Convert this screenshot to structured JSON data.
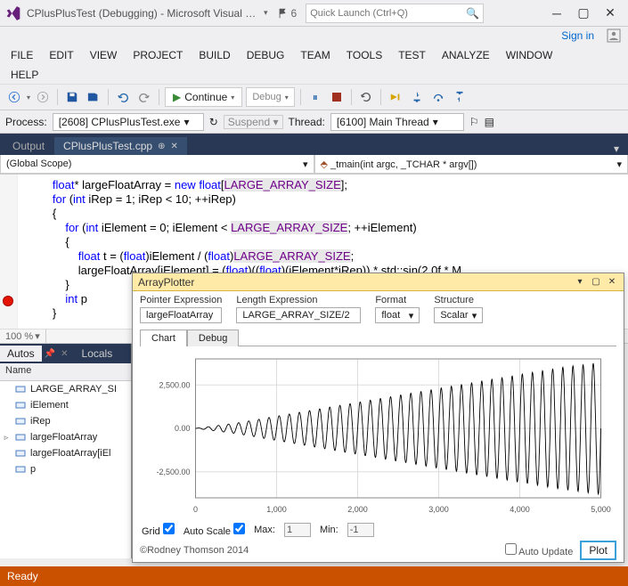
{
  "title": "CPlusPlusTest (Debugging) - Microsoft Visual Studi...",
  "down_icon": "▾",
  "notification_count": "6",
  "search_placeholder": "Quick Launch (Ctrl+Q)",
  "signin": "Sign in",
  "menu": [
    "FILE",
    "EDIT",
    "VIEW",
    "PROJECT",
    "BUILD",
    "DEBUG",
    "TEAM",
    "TOOLS",
    "TEST",
    "ANALYZE",
    "WINDOW",
    "HELP"
  ],
  "toolbar": {
    "continue": "Continue",
    "config": "Debug"
  },
  "toolbar2": {
    "process_label": "Process:",
    "process_value": "[2608] CPlusPlusTest.exe",
    "suspend_label": "Suspend",
    "thread_label": "Thread:",
    "thread_value": "[6100] Main Thread"
  },
  "tabs": {
    "output": "Output",
    "file": "CPlusPlusTest.cpp"
  },
  "navbar": {
    "scope": "(Global Scope)",
    "func": "_tmain(int argc, _TCHAR * argv[])"
  },
  "code_lines": [
    {
      "indent": 2,
      "tokens": [
        {
          "t": "float",
          "c": "kw"
        },
        {
          "t": "* largeFloatArray = ",
          "c": ""
        },
        {
          "t": "new",
          "c": "kw"
        },
        {
          "t": " ",
          "c": ""
        },
        {
          "t": "float",
          "c": "kw"
        },
        {
          "t": "[",
          "c": ""
        },
        {
          "t": "LARGE_ARRAY_SIZE",
          "c": "macro"
        },
        {
          "t": "];",
          "c": ""
        }
      ]
    },
    {
      "indent": 2,
      "tokens": [
        {
          "t": "for",
          "c": "kw"
        },
        {
          "t": " (",
          "c": ""
        },
        {
          "t": "int",
          "c": "kw"
        },
        {
          "t": " iRep = 1; iRep < 10; ++iRep)",
          "c": ""
        }
      ]
    },
    {
      "indent": 2,
      "tokens": [
        {
          "t": "{",
          "c": ""
        }
      ]
    },
    {
      "indent": 3,
      "tokens": [
        {
          "t": "for",
          "c": "kw"
        },
        {
          "t": " (",
          "c": ""
        },
        {
          "t": "int",
          "c": "kw"
        },
        {
          "t": " iElement = 0; iElement < ",
          "c": ""
        },
        {
          "t": "LARGE_ARRAY_SIZE",
          "c": "macro"
        },
        {
          "t": "; ++iElement)",
          "c": ""
        }
      ]
    },
    {
      "indent": 3,
      "tokens": [
        {
          "t": "{",
          "c": ""
        }
      ]
    },
    {
      "indent": 4,
      "tokens": [
        {
          "t": "float",
          "c": "kw"
        },
        {
          "t": " t = (",
          "c": ""
        },
        {
          "t": "float",
          "c": "kw"
        },
        {
          "t": ")iElement / (",
          "c": ""
        },
        {
          "t": "float",
          "c": "kw"
        },
        {
          "t": ")",
          "c": ""
        },
        {
          "t": "LARGE_ARRAY_SIZE",
          "c": "macro"
        },
        {
          "t": ";",
          "c": ""
        }
      ]
    },
    {
      "indent": 4,
      "tokens": [
        {
          "t": "largeFloatArray[iElement] = (",
          "c": ""
        },
        {
          "t": "float",
          "c": "kw"
        },
        {
          "t": ")((",
          "c": ""
        },
        {
          "t": "float",
          "c": "kw"
        },
        {
          "t": ")(iElement*iRep)) * std::sin(2.0f * M",
          "c": ""
        }
      ]
    },
    {
      "indent": 3,
      "tokens": [
        {
          "t": "}",
          "c": ""
        }
      ]
    },
    {
      "indent": 3,
      "tokens": [
        {
          "t": "int",
          "c": "kw"
        },
        {
          "t": " p ",
          "c": ""
        }
      ]
    },
    {
      "indent": 2,
      "tokens": [
        {
          "t": "}",
          "c": ""
        }
      ]
    }
  ],
  "zoom": "100 %",
  "autos": {
    "tabs": [
      "Autos",
      "Locals"
    ],
    "header": "Name",
    "rows": [
      {
        "exp": "",
        "name": "LARGE_ARRAY_SI"
      },
      {
        "exp": "",
        "name": "iElement"
      },
      {
        "exp": "",
        "name": "iRep"
      },
      {
        "exp": "▹",
        "name": "largeFloatArray"
      },
      {
        "exp": "",
        "name": "largeFloatArray[iEl"
      },
      {
        "exp": "",
        "name": "p"
      }
    ]
  },
  "plotter": {
    "title": "ArrayPlotter",
    "labels": {
      "pointer": "Pointer Expression",
      "length": "Length Expression",
      "format": "Format",
      "structure": "Structure"
    },
    "values": {
      "pointer": "largeFloatArray",
      "length": "LARGE_ARRAY_SIZE/2",
      "format": "float",
      "structure": "Scalar"
    },
    "tabs": [
      "Chart",
      "Debug"
    ],
    "controls": {
      "grid": "Grid",
      "autoscale": "Auto Scale",
      "max_label": "Max:",
      "max_value": "1",
      "min_label": "Min:",
      "min_value": "-1"
    },
    "copyright": "©Rodney Thomson 2014",
    "autoupdate": "Auto Update",
    "plotbtn": "Plot"
  },
  "chart_data": {
    "type": "line",
    "title": "",
    "xlabel": "",
    "ylabel": "",
    "xlim": [
      0,
      5000
    ],
    "ylim": [
      -4000,
      4000
    ],
    "xticks": [
      0,
      1000,
      2000,
      3000,
      4000,
      5000
    ],
    "yticks": [
      -2500,
      0,
      2500
    ],
    "description": "y = x * sin(2*pi*f*x) style growing sinusoid, ~40 cycles over [0,5000], envelope roughly linear from 0 to ±3800",
    "envelope_pts": [
      [
        0,
        0
      ],
      [
        500,
        300
      ],
      [
        1000,
        700
      ],
      [
        1500,
        1100
      ],
      [
        2000,
        1500
      ],
      [
        2500,
        1900
      ],
      [
        3000,
        2300
      ],
      [
        3500,
        2700
      ],
      [
        4000,
        3100
      ],
      [
        4500,
        3500
      ],
      [
        5000,
        3800
      ]
    ],
    "period": 125
  },
  "status": "Ready"
}
